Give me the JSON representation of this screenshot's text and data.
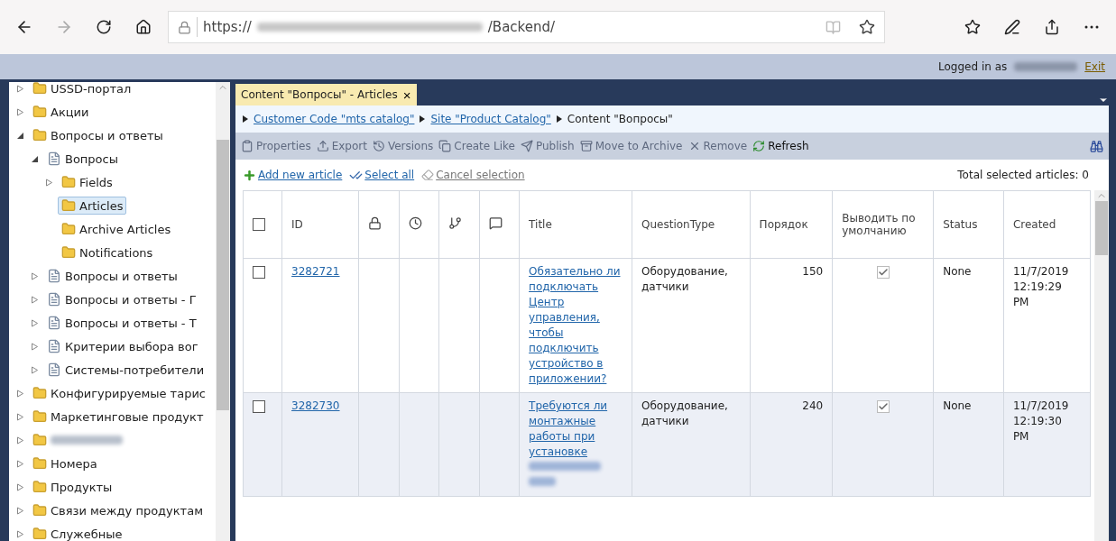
{
  "browser": {
    "url_start": "https://",
    "url_redacted": true,
    "url_end": "/Backend/"
  },
  "header": {
    "logged_in_label": "Logged in as",
    "user_redacted": true,
    "exit": "Exit"
  },
  "tree": [
    {
      "label": "USSD-портал",
      "kind": "folder",
      "expanded": false,
      "leaf": false,
      "selected": false
    },
    {
      "label": "Акции",
      "kind": "folder",
      "expanded": false,
      "leaf": false,
      "selected": false
    },
    {
      "label": "Вопросы и ответы",
      "kind": "folder",
      "expanded": true,
      "leaf": false,
      "selected": false,
      "children": [
        {
          "label": "Вопросы",
          "kind": "doc",
          "expanded": true,
          "leaf": false,
          "selected": false,
          "children": [
            {
              "label": "Fields",
              "kind": "folder",
              "expanded": false,
              "leaf": false,
              "selected": false
            },
            {
              "label": "Articles",
              "kind": "folder",
              "selected": true
            },
            {
              "label": "Archive Articles",
              "kind": "folder",
              "selected": false
            },
            {
              "label": "Notifications",
              "kind": "folder",
              "selected": false
            }
          ]
        },
        {
          "label": "Вопросы и ответы",
          "kind": "doc",
          "expanded": false,
          "leaf": false,
          "selected": false
        },
        {
          "label": "Вопросы и ответы - Г",
          "kind": "doc",
          "expanded": false,
          "leaf": false,
          "selected": false
        },
        {
          "label": "Вопросы и ответы - Т",
          "kind": "doc",
          "expanded": false,
          "leaf": false,
          "selected": false
        },
        {
          "label": "Критерии выбора вог",
          "kind": "doc",
          "expanded": false,
          "leaf": false,
          "selected": false
        },
        {
          "label": "Системы-потребители",
          "kind": "doc",
          "expanded": false,
          "leaf": false,
          "selected": false
        }
      ]
    },
    {
      "label": "Конфигурируемые тарис",
      "kind": "folder",
      "expanded": false,
      "leaf": false,
      "selected": false
    },
    {
      "label": "Маркетинговые продукт",
      "kind": "folder",
      "expanded": false,
      "leaf": false,
      "selected": false
    },
    {
      "redacted": true,
      "kind": "folder",
      "expanded": false,
      "leaf": false,
      "selected": false
    },
    {
      "label": "Номера",
      "kind": "folder",
      "expanded": false,
      "leaf": false,
      "selected": false
    },
    {
      "label": "Продукты",
      "kind": "folder",
      "expanded": false,
      "leaf": false,
      "selected": false
    },
    {
      "label": "Связи между продуктам",
      "kind": "folder",
      "expanded": false,
      "leaf": false,
      "selected": false
    },
    {
      "label": "Служебные",
      "kind": "folder",
      "expanded": false,
      "leaf": false,
      "selected": false
    }
  ],
  "tab": {
    "label": "Content \"Вопросы\" - Articles",
    "close": "×",
    "selected": true
  },
  "breadcrumb": [
    {
      "label": "Customer Code \"mts catalog\"",
      "link": true
    },
    {
      "label": "Site \"Product Catalog\"",
      "link": true
    },
    {
      "label": "Content \"Вопросы\"",
      "link": false
    }
  ],
  "toolbar": [
    {
      "label": "Properties",
      "kind": "properties",
      "disabled": true
    },
    {
      "label": "Export",
      "kind": "export",
      "disabled": true
    },
    {
      "label": "Versions",
      "kind": "versions",
      "disabled": true
    },
    {
      "label": "Create Like",
      "kind": "copy",
      "disabled": true
    },
    {
      "label": "Publish",
      "kind": "publish",
      "disabled": true
    },
    {
      "label": "Move to Archive",
      "kind": "archive",
      "disabled": true
    },
    {
      "label": "Remove",
      "kind": "remove",
      "disabled": true
    },
    {
      "label": "Refresh",
      "kind": "refresh",
      "disabled": false
    }
  ],
  "actions": [
    {
      "label": "Add new article",
      "kind": "add",
      "disabled": false
    },
    {
      "label": "Select all",
      "kind": "select",
      "disabled": false
    },
    {
      "label": "Cancel selection",
      "kind": "cancel",
      "disabled": true
    }
  ],
  "total_selected": "Total selected articles: 0",
  "table": {
    "columns": [
      {
        "kind": "check",
        "checked": false
      },
      {
        "kind": "text",
        "label": "ID"
      },
      {
        "kind": "icon"
      },
      {
        "kind": "icon"
      },
      {
        "kind": "icon"
      },
      {
        "kind": "icon"
      },
      {
        "kind": "text",
        "label": "Title"
      },
      {
        "kind": "text",
        "label": "QuestionType"
      },
      {
        "kind": "text",
        "label": "Порядок"
      },
      {
        "kind": "text",
        "label": "Выводить по умолчанию"
      },
      {
        "kind": "text",
        "label": "Status"
      },
      {
        "kind": "text",
        "label": "Created"
      }
    ],
    "rows": [
      {
        "checked": false,
        "id": "3282721",
        "title": "Обязательно ли подключать Центр управления, чтобы подключить устройство в приложении?",
        "title_redacted": false,
        "question_type": "Оборудование, датчики",
        "order": "150",
        "default_output": true,
        "status": "None",
        "created": "11/7/2019 12:19:29 PM"
      },
      {
        "checked": false,
        "id": "3282730",
        "title": "Требуются ли монтажные работы при установке",
        "title_redacted": true,
        "question_type": "Оборудование, датчики",
        "order": "240",
        "default_output": true,
        "status": "None",
        "created": "11/7/2019 12:19:30 PM"
      }
    ]
  }
}
